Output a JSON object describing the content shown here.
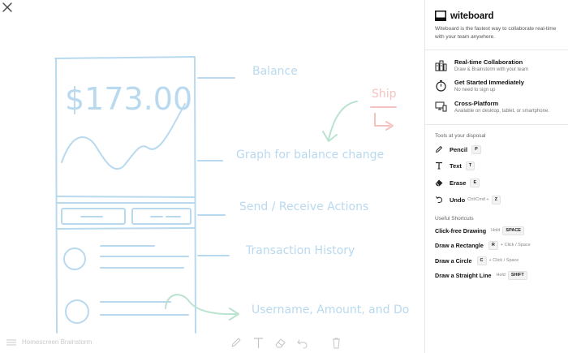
{
  "document": {
    "title": "Homescreen Brainstorm"
  },
  "sketch": {
    "balance_amount": "$173.00",
    "labels": {
      "balance": "Balance",
      "graph": "Graph for balance change",
      "actions": "Send / Receive Actions",
      "history": "Transaction History",
      "details": "Username, Amount, and Do",
      "ship": "Ship"
    },
    "colors": {
      "sketch": "#b9d9ef",
      "arrow": "#b9e3cf",
      "pink": "#f3c3c0"
    }
  },
  "bottom_toolbar": {
    "icons": [
      "pencil-icon",
      "text-icon",
      "eraser-icon",
      "undo-icon",
      "trash-icon"
    ]
  },
  "sidebar": {
    "brand": "witeboard",
    "tagline": "Witeboard is the fastest way to collaborate real-time with your team anywhere.",
    "features": [
      {
        "icon": "collaboration-icon",
        "title": "Real-time Collaboration",
        "subtitle": "Draw & Brainstorm with your team"
      },
      {
        "icon": "stopwatch-icon",
        "title": "Get Started Immediately",
        "subtitle": "No need to sign up"
      },
      {
        "icon": "devices-icon",
        "title": "Cross-Platform",
        "subtitle": "Available on desktop, tablet, or smartphone."
      }
    ],
    "tools_heading": "Tools at your disposal",
    "tools": [
      {
        "icon": "pencil-icon",
        "name": "Pencil",
        "key": "P"
      },
      {
        "icon": "text-icon",
        "name": "Text",
        "key": "T"
      },
      {
        "icon": "eraser-icon",
        "name": "Erase",
        "key": "E"
      },
      {
        "icon": "undo-icon",
        "name": "Undo",
        "modifier": "Ctrl/Cmd +",
        "key": "Z"
      }
    ],
    "shortcuts_heading": "Useful Shortcuts",
    "shortcuts": [
      {
        "name": "Click-free Drawing",
        "prefix": "Hold",
        "key": "SPACE",
        "suffix": ""
      },
      {
        "name": "Draw a Rectangle",
        "prefix": "",
        "key": "R",
        "suffix": "+ Click / Space"
      },
      {
        "name": "Draw a Circle",
        "prefix": "",
        "key": "C",
        "suffix": "+ Click / Space"
      },
      {
        "name": "Draw a Straight Line",
        "prefix": "Hold",
        "key": "SHIFT",
        "suffix": ""
      }
    ]
  }
}
